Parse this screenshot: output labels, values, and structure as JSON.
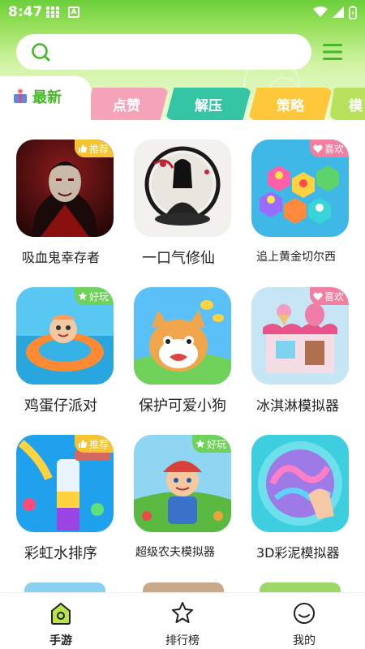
{
  "status": {
    "time": "8:47"
  },
  "colors": {
    "brand_green": "#45b828",
    "header_top": "#6ccf3a",
    "tab_pink": "#f5a3b9",
    "tab_teal": "#35c5a4",
    "tab_yellow": "#ffc83b",
    "tab_lime": "#b9e15d",
    "badge_yellow": "#f7c431",
    "badge_pink": "#f27ea0",
    "badge_green": "#6fd25a"
  },
  "search": {
    "placeholder": ""
  },
  "tabs": {
    "active_label": "最新",
    "items": [
      "点赞",
      "解压",
      "策略",
      "模"
    ]
  },
  "games": [
    {
      "title": "吸血鬼幸存者",
      "badge": "推荐",
      "badge_type": "thumb"
    },
    {
      "title": "一口气修仙",
      "badge": "",
      "badge_type": ""
    },
    {
      "title": "追上黄金切尔西",
      "badge": "喜欢",
      "badge_type": "heart"
    },
    {
      "title": "鸡蛋仔派对",
      "badge": "好玩",
      "badge_type": "star"
    },
    {
      "title": "保护可爱小狗",
      "badge": "",
      "badge_type": ""
    },
    {
      "title": "冰淇淋模拟器",
      "badge": "喜欢",
      "badge_type": "heart"
    },
    {
      "title": "彩虹水排序",
      "badge": "推荐",
      "badge_type": "thumb"
    },
    {
      "title": "超级农夫模拟器",
      "badge": "好玩",
      "badge_type": "star"
    },
    {
      "title": "3D彩泥模拟器",
      "badge": "",
      "badge_type": ""
    }
  ],
  "bottom_nav": [
    {
      "label": "手游",
      "icon": "gamepad-house-icon",
      "active": true
    },
    {
      "label": "排行榜",
      "icon": "star-trophy-icon",
      "active": false
    },
    {
      "label": "我的",
      "icon": "smile-face-icon",
      "active": false
    }
  ]
}
